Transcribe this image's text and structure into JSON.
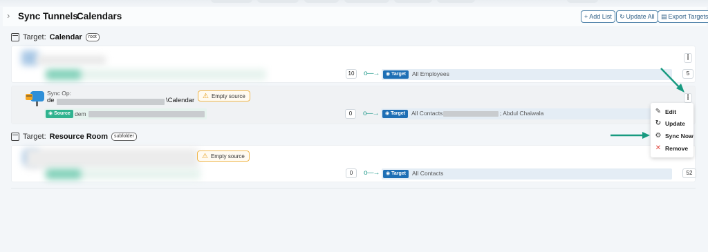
{
  "breadcrumb": {
    "parent": "Sync Tunnels",
    "current": "Calendars"
  },
  "header_buttons": {
    "add_list": "+ Add List",
    "update_all": "Update All",
    "export_targets": "Export Targets"
  },
  "sections": [
    {
      "prefix": "Target:",
      "name": "Calendar",
      "tag": "root",
      "rows": [
        {
          "source_count": "10",
          "target_label": "Target",
          "target_text": "All Employees",
          "target_count": "5"
        },
        {
          "syncop_label": "Sync Op:",
          "syncop_path_prefix": "de",
          "syncop_path_suffix": "\\Calendar",
          "warning": "Empty source",
          "source_label": "Source",
          "source_text": "dem",
          "source_count": "0",
          "target_label": "Target",
          "target_text": "All Contacts;",
          "target_text_2": "; Abdul Chaiwala"
        }
      ]
    },
    {
      "prefix": "Target:",
      "name": "Resource Room",
      "tag": "subfolder",
      "rows": [
        {
          "warning": "Empty source",
          "source_count": "0",
          "target_label": "Target",
          "target_text": "All Contacts",
          "target_count": "52"
        }
      ]
    }
  ],
  "context_menu": {
    "items": [
      {
        "label": "Edit",
        "icon": "pencil-icon"
      },
      {
        "label": "Update",
        "icon": "refresh-icon"
      },
      {
        "label": "Sync Now",
        "icon": "gear-icon"
      },
      {
        "label": "Remove",
        "icon": "close-icon"
      }
    ]
  },
  "colors": {
    "accent_blue": "#1e6fb5",
    "source_green": "#2fb38f",
    "warning_orange": "#f0b64a",
    "annotation_teal": "#179a80",
    "remove_red": "#e0443a"
  }
}
